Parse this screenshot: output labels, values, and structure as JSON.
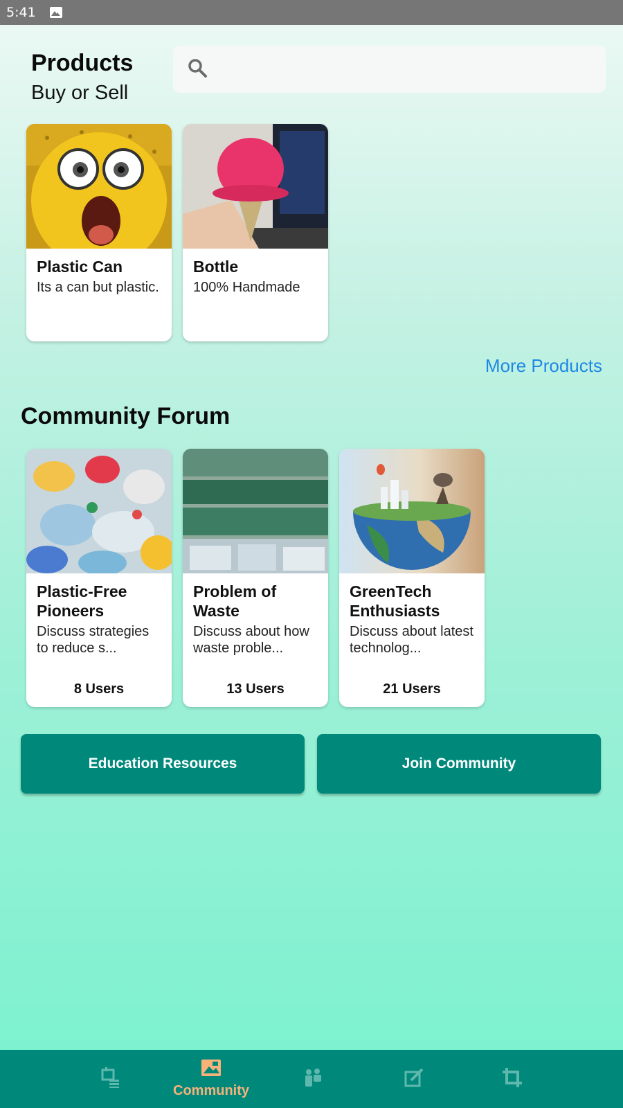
{
  "status_bar": {
    "time": "5:41",
    "icons": [
      "image-icon"
    ]
  },
  "header": {
    "title": "Products",
    "subtitle": "Buy or Sell"
  },
  "search": {
    "placeholder": "",
    "value": "",
    "icon": "search-icon"
  },
  "products": [
    {
      "title": "Plastic Can",
      "description": "Its a can but plastic.",
      "image": "surprised-yellow-face-photo"
    },
    {
      "title": "Bottle",
      "description": "100% Handmade",
      "image": "crochet-ice-cream-photo"
    }
  ],
  "more_products_label": "More Products",
  "forum": {
    "title": "Community Forum",
    "items": [
      {
        "title": "Plastic-Free Pioneers",
        "description": "Discuss strategies to reduce s...",
        "users": "8 Users",
        "image": "plastic-waste-photo"
      },
      {
        "title": "Problem of Waste",
        "description": "Discuss about how waste proble...",
        "users": "13 Users",
        "image": "baled-bottles-photo"
      },
      {
        "title": "GreenTech Enthusiasts",
        "description": "Discuss about latest technolog...",
        "users": "21 Users",
        "image": "earth-city-photo"
      }
    ]
  },
  "buttons": {
    "education": "Education Resources",
    "join": "Join Community"
  },
  "bottom_nav": {
    "items": [
      {
        "icon": "calendar-list-icon",
        "label": ""
      },
      {
        "icon": "image-icon",
        "label": "Community",
        "active": true
      },
      {
        "icon": "people-icon",
        "label": ""
      },
      {
        "icon": "edit-icon",
        "label": ""
      },
      {
        "icon": "crop-icon",
        "label": ""
      }
    ]
  },
  "colors": {
    "accent": "#00897b",
    "link": "#1e88e5",
    "nav_active": "#f7b27a",
    "nav_icon": "#5fb8ad"
  }
}
